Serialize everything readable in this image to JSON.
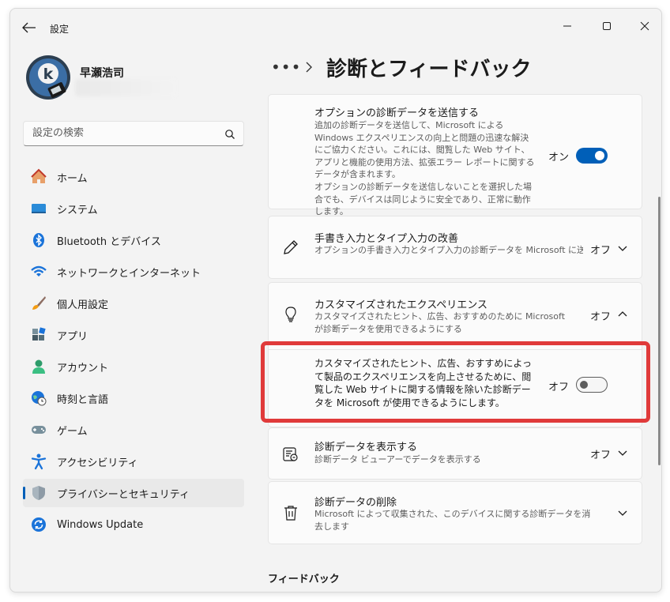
{
  "window": {
    "title": "設定"
  },
  "profile": {
    "name": "早瀬浩司"
  },
  "search": {
    "placeholder": "設定の検索"
  },
  "nav": {
    "items": [
      {
        "label": "ホーム",
        "icon": "home-icon"
      },
      {
        "label": "システム",
        "icon": "system-icon"
      },
      {
        "label": "Bluetooth とデバイス",
        "icon": "bluetooth-icon"
      },
      {
        "label": "ネットワークとインターネット",
        "icon": "wifi-icon"
      },
      {
        "label": "個人用設定",
        "icon": "brush-icon"
      },
      {
        "label": "アプリ",
        "icon": "apps-icon"
      },
      {
        "label": "アカウント",
        "icon": "account-icon"
      },
      {
        "label": "時刻と言語",
        "icon": "globe-clock-icon"
      },
      {
        "label": "ゲーム",
        "icon": "gamepad-icon"
      },
      {
        "label": "アクセシビリティ",
        "icon": "accessibility-icon"
      },
      {
        "label": "プライバシーとセキュリティ",
        "icon": "shield-icon",
        "active": true
      },
      {
        "label": "Windows Update",
        "icon": "update-icon"
      }
    ]
  },
  "header": {
    "breadcrumb_more": "•••",
    "title": "診断とフィードバック"
  },
  "cards": {
    "optional_data": {
      "title": "オプションの診断データを送信する",
      "desc1": "追加の診断データを送信して、Microsoft による Windows エクスペリエンスの向上と問題の迅速な解決にご協力ください。これには、閲覧した Web サイト、アプリと機能の使用方法、拡張エラー レポートに関するデータが含まれます。",
      "desc2": "オプションの診断データを送信しないことを選択した場合でも、デバイスは同じように安全であり、正常に動作します。",
      "state": "オン"
    },
    "handwriting": {
      "title": "手書き入力とタイプ入力の改善",
      "desc": "オプションの手書き入力とタイプ入力の診断データを Microsoft に送信",
      "state": "オフ"
    },
    "tailored": {
      "title": "カスタマイズされたエクスペリエンス",
      "desc": "カスタマイズされたヒント、広告、おすすめのために Microsoft が診断データを使用できるようにする",
      "state": "オフ",
      "sub_desc": "カスタマイズされたヒント、広告、おすすめによって製品のエクスペリエンスを向上させるために、閲覧した Web サイトに関する情報を除いた診断データを Microsoft が使用できるようにします。",
      "sub_state": "オフ"
    },
    "view_data": {
      "title": "診断データを表示する",
      "desc": "診断データ ビューアーでデータを表示する",
      "state": "オフ"
    },
    "delete_data": {
      "title": "診断データの削除",
      "desc": "Microsoft によって収集された、このデバイスに関する診断データを消去します"
    }
  },
  "section": {
    "feedback": "フィードバック"
  },
  "colors": {
    "accent": "#005fb8",
    "highlight": "#e03a3a"
  }
}
